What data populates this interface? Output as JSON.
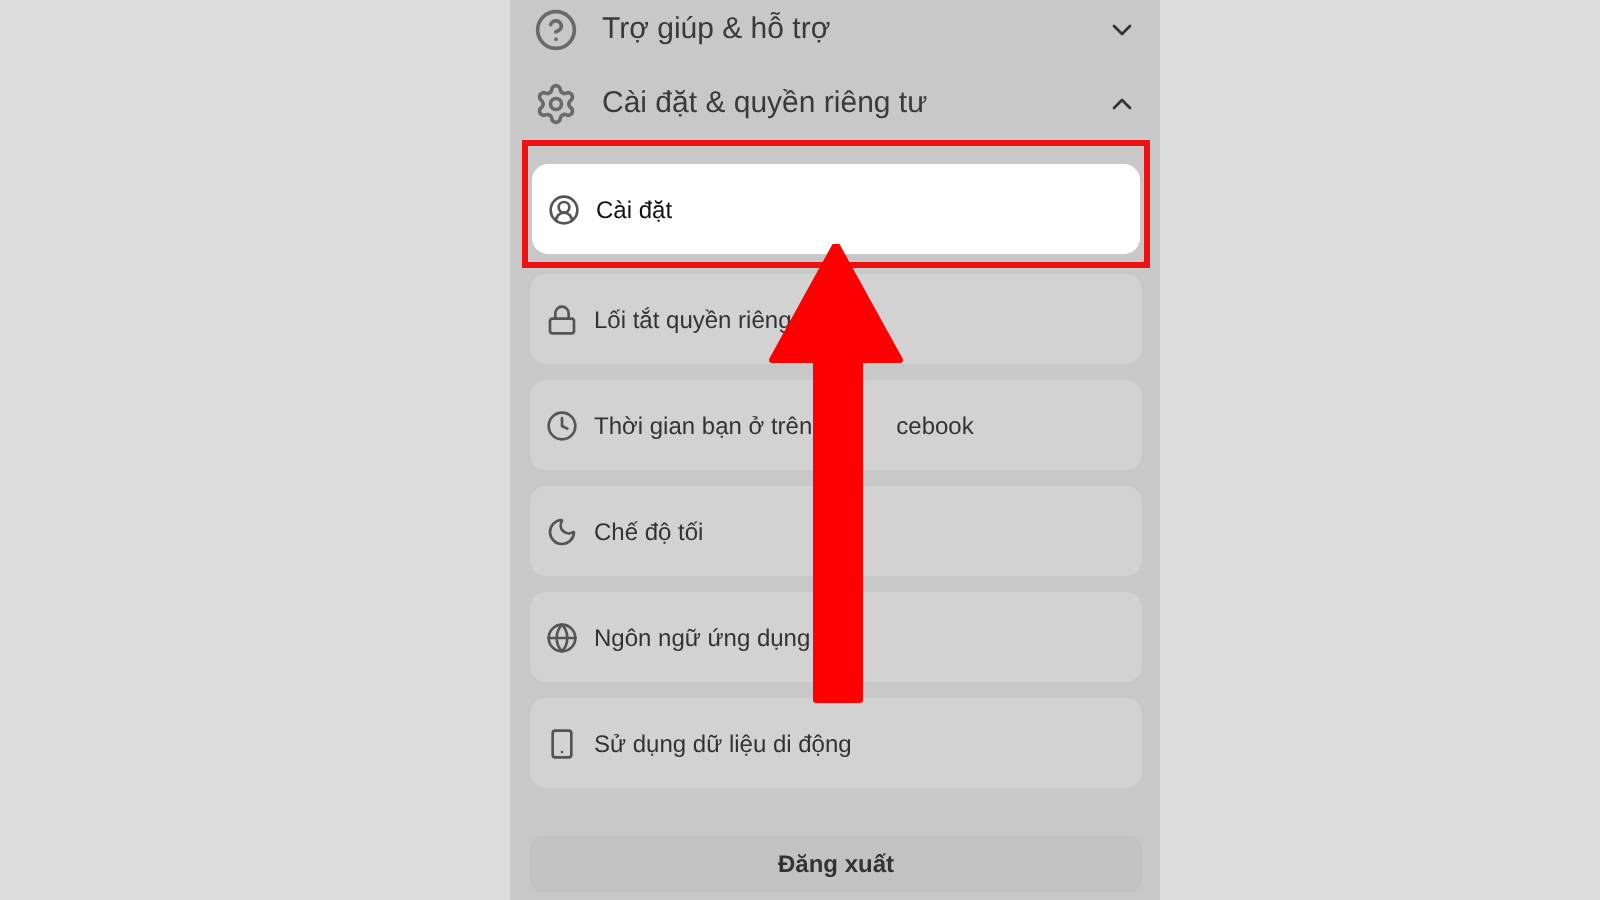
{
  "sections": [
    {
      "label": "Trợ giúp & hỗ trợ",
      "kind": "help",
      "expanded": false
    },
    {
      "label": "Cài đặt & quyền riêng tư",
      "kind": "gear",
      "expanded": true
    }
  ],
  "items": [
    {
      "label": "Cài đặt",
      "kind": "user",
      "selected": true
    },
    {
      "label": "Lối tắt quyền riêng",
      "kind": "lock",
      "selected": false
    },
    {
      "label": "Thời gian bạn ở trên",
      "label_after": "cebook",
      "kind": "clock",
      "selected": false
    },
    {
      "label": "Chế độ tối",
      "kind": "moon",
      "selected": false
    },
    {
      "label": "Ngôn ngữ ứng dụng",
      "kind": "globe",
      "selected": false
    },
    {
      "label": "Sử dụng dữ liệu di động",
      "kind": "phone",
      "selected": false
    }
  ],
  "logout_button": "Đăng xuất"
}
